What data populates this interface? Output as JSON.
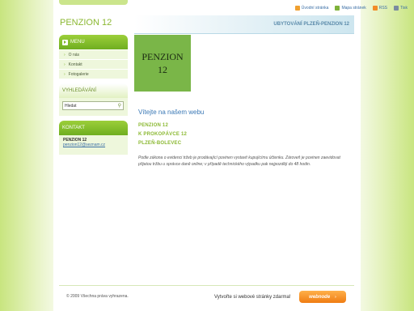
{
  "header": {
    "site_title": "PENZION 12",
    "subtitle": "UBYTOVÁNÍ PLZEŇ-PENZION 12",
    "links": [
      {
        "label": "Úvodní stránka",
        "icon": "home-icon"
      },
      {
        "label": "Mapa stránek",
        "icon": "sitemap-icon"
      },
      {
        "label": "RSS",
        "icon": "rss-icon"
      },
      {
        "label": "Tisk",
        "icon": "print-icon"
      }
    ]
  },
  "sidebar": {
    "menu_title": "MENU",
    "items": [
      {
        "label": "O nás"
      },
      {
        "label": "Kontakt"
      },
      {
        "label": "Fotogalerie"
      }
    ],
    "search_title": "VYHLEDÁVÁNÍ",
    "search_value": "Hledat",
    "contact_title": "KONTAKT",
    "contact_name": "PENZION 12",
    "contact_email": "penzion12@seznam.cz"
  },
  "main": {
    "logo_line1": "PENZION",
    "logo_line2": "12",
    "welcome": "Vítejte na našem webu",
    "address": [
      "PENZION 12",
      "K PROKOPÁVCE 12",
      "PLZEŇ-BOLEVEC"
    ],
    "notice": "Podle zákona o evidenci tržeb je prodávající povinen vystavit kupujícímu účtenku. Zároveň je povinen zaevidovat přijatou tržbu u správce daně online; v případě technického výpadku pak nejpozději do 48 hodin."
  },
  "footer": {
    "copyright": "© 2009 Všechna práva vyhrazena.",
    "create_text": "Vytvořte si webové stránky zdarma!",
    "button_label": "webnode"
  },
  "colors": {
    "accent_green": "#8bb832",
    "menu_green": "#7fb62a",
    "link_blue": "#3a6ea5",
    "button_orange": "#f07c12"
  }
}
